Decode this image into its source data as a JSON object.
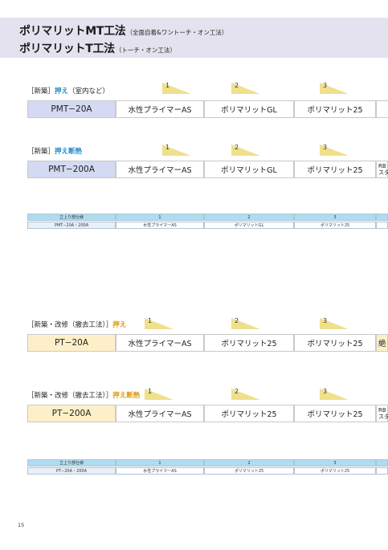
{
  "header": {
    "line1_main": "ポリマリットMT工法",
    "line1_sub": "（全面自着&ワントーチ・オン工法）",
    "line2_main": "ポリマリットT工法",
    "line2_sub": "（トーチ・オン工法）"
  },
  "sections": [
    {
      "label_prefix": "［新築］",
      "label_accent": "押え",
      "label_suffix": "（室内など）",
      "steps": [
        "1",
        "2",
        "3"
      ],
      "cells": [
        "PMT−20A",
        "水性プライマーAS",
        "ポリマリットGL",
        "ポリマリット25",
        ""
      ],
      "last_small": []
    },
    {
      "label_prefix": "［新築］",
      "label_accent": "押え断熱",
      "label_suffix": "",
      "steps": [
        "1",
        "2",
        "3"
      ],
      "cells": [
        "PMT−200A",
        "水性プライマーAS",
        "ポリマリットGL",
        "ポリマリット25",
        ""
      ],
      "last_small": [
        "RB",
        "スタ"
      ]
    },
    {
      "label_prefix": "［新築・改修（撤去工法）］",
      "label_accent": "押え",
      "label_suffix": "",
      "steps": [
        "1",
        "2",
        "3"
      ],
      "cells": [
        "PT−20A",
        "水性プライマーAS",
        "ポリマリット25",
        "ポリマリット25",
        "絶"
      ],
      "last_small": []
    },
    {
      "label_prefix": "［新築・改修（撤去工法）］",
      "label_accent": "押え断熱",
      "label_suffix": "",
      "steps": [
        "1",
        "2",
        "3"
      ],
      "cells": [
        "PT−200A",
        "水性プライマーAS",
        "ポリマリット25",
        "ポリマリット25",
        ""
      ],
      "last_small": [
        "RB",
        "スタ"
      ]
    }
  ],
  "mini_tables": [
    {
      "head": [
        "立上り部仕様",
        "1",
        "2",
        "3",
        ""
      ],
      "body": [
        "PMT−20A・200A",
        "水性プライマーAS",
        "ポリマリットGL",
        "ポリマリット25",
        ""
      ]
    },
    {
      "head": [
        "立上り部仕様",
        "1",
        "2",
        "3",
        ""
      ],
      "body": [
        "PT−20A・200A",
        "水性プライマーAS",
        "ポリマリット25",
        "ポリマリット25",
        ""
      ]
    }
  ],
  "page_number": "15",
  "colors": {
    "header_bg": "#e4e2ef",
    "accent_blue": "#2288cc",
    "accent_gold": "#d99a10",
    "step_flag": "#efe08c",
    "cell_blue": "#d4daf2",
    "cell_gold": "#fdf0c8",
    "mini_head": "#aedcf0"
  }
}
